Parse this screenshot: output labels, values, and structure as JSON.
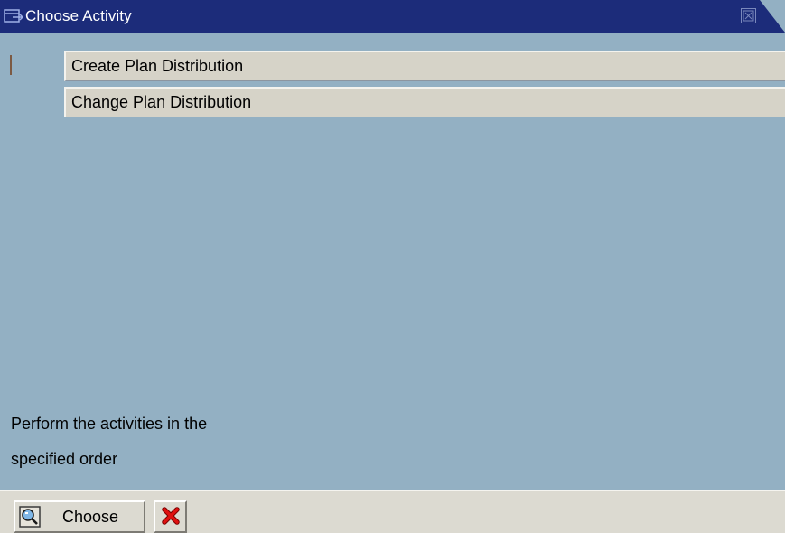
{
  "window": {
    "title": "Choose Activity",
    "title_icon": "window-menu-icon",
    "close_icon": "close-icon"
  },
  "activities": [
    {
      "label": "Create Plan Distribution"
    },
    {
      "label": "Change Plan Distribution"
    }
  ],
  "hint": {
    "line1": "Perform the activities in the",
    "line2": "specified order"
  },
  "footer": {
    "choose_label": "Choose",
    "choose_icon": "choose-magnifier-icon",
    "cancel_icon": "cancel-x-icon"
  },
  "colors": {
    "titlebar": "#1c2c7a",
    "background": "#93b0c3",
    "row": "#d6d3c8",
    "footer": "#dcdad1",
    "cancel": "#d40000"
  }
}
